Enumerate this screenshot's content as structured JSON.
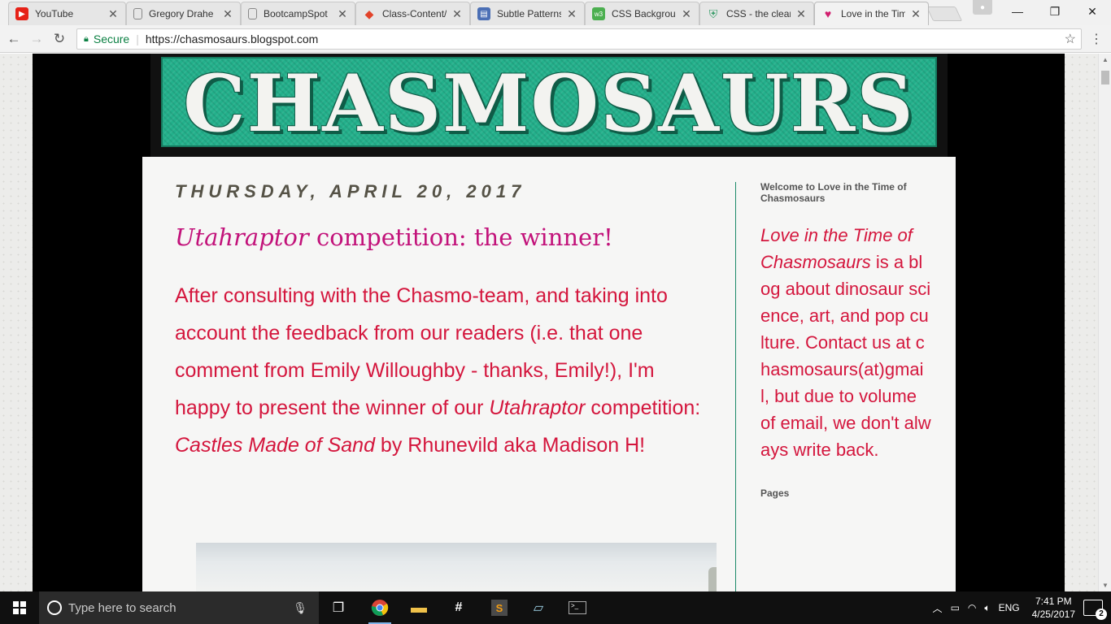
{
  "tabs": [
    {
      "label": "YouTube",
      "icon": "youtube-icon",
      "color": "#e62117"
    },
    {
      "label": "Gregory Drahe",
      "icon": "document-icon",
      "color": "#888888"
    },
    {
      "label": "BootcampSpot",
      "icon": "document-icon",
      "color": "#888888"
    },
    {
      "label": "Class-Content/",
      "icon": "gitlab-icon",
      "color": "#e2432a"
    },
    {
      "label": "Subtle Patterns",
      "icon": "subtle-patterns-icon",
      "color": "#4b6fb5"
    },
    {
      "label": "CSS Backgroun",
      "icon": "w3schools-icon",
      "color": "#4caf50"
    },
    {
      "label": "CSS - the clear",
      "icon": "css-shield-icon",
      "color": "#3a9e6a"
    },
    {
      "label": "Love in the Tim",
      "icon": "heart-icon",
      "color": "#d11e6e"
    }
  ],
  "address": {
    "secure_label": "Secure",
    "url": "https://chasmosaurs.blogspot.com"
  },
  "blog": {
    "banner_title": "CHASMOSAURS",
    "date_header": "THURSDAY, APRIL 20, 2017",
    "post_title_italic": "Utahraptor",
    "post_title_rest": " competition: the winner!",
    "body_part1": "After consulting with the Chasmo-team, and taking into account the feedback from our readers (i.e. that one comment from Emily Willoughby - thanks, Emily!), I'm happy to present the winner of our ",
    "body_italic1": "Utahraptor",
    "body_part2": " competition: ",
    "body_italic2": "Castles Made of Sand",
    "body_part3": " by Rhunevild aka Madison H!"
  },
  "sidebar": {
    "welcome_heading": "Welcome to Love in the Time of Chasmosaurs",
    "welcome_italic": "Love in the Time of Chasmosaurs",
    "welcome_text": " is a blog about dinosaur science, art, and pop culture. Contact us at chasmosaurs(at)gmail, but due to volume of email, we don't always write back.",
    "pages_heading": "Pages"
  },
  "taskbar": {
    "search_placeholder": "Type here to search",
    "language": "ENG",
    "time": "7:41 PM",
    "date": "4/25/2017",
    "notification_count": "2"
  },
  "colors": {
    "accent_green": "#23b08b",
    "title_magenta": "#c2127a",
    "body_red": "#d4163d"
  }
}
